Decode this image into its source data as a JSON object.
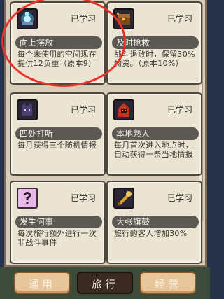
{
  "cards": [
    {
      "name": "向上摆放",
      "status": "已学习",
      "desc": "每个未使用的空间现在提供12负重（原本9）",
      "icon": "glowing-crystal-icon"
    },
    {
      "name": "及时抢救",
      "status": "已学习",
      "desc": "战斗退败时，保留30%物资。（原本10%）",
      "icon": "treasure-chest-icon"
    },
    {
      "name": "四处打听",
      "status": "已学习",
      "desc": "每月获得三个随机情报",
      "icon": "listening-cat-icon"
    },
    {
      "name": "本地熟人",
      "status": "已学习",
      "desc": "每月首次进入地点时，自动获得一条当地情报",
      "icon": "hooded-figure-icon"
    },
    {
      "name": "发生何事",
      "status": "已学习",
      "desc": "每次旅行额外进行一次非战斗事件",
      "icon": "question-mark-icon"
    },
    {
      "name": "大张旗鼓",
      "status": "已学习",
      "desc": "旅行的客人增加30%",
      "icon": "golden-horn-icon"
    }
  ],
  "tabs": [
    {
      "label": "通用",
      "active": false
    },
    {
      "label": "旅行",
      "active": true
    },
    {
      "label": "经营",
      "active": false
    }
  ],
  "annotation": {
    "color": "#e8322a"
  }
}
